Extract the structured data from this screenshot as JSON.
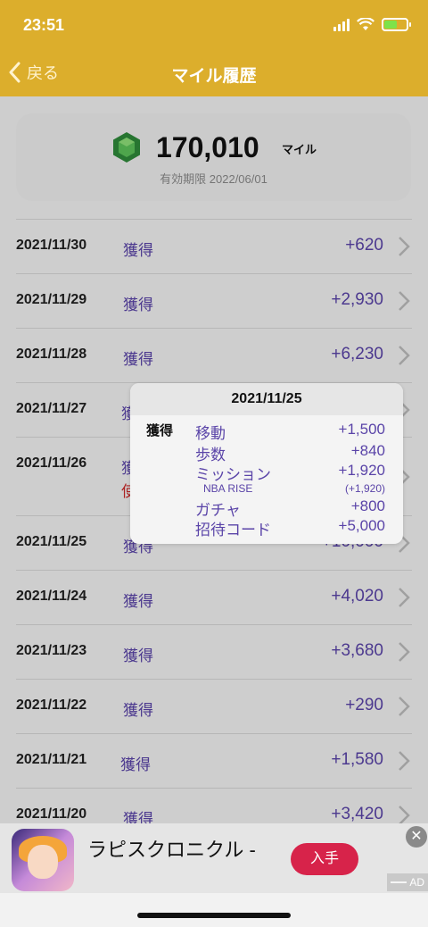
{
  "status": {
    "time": "23:51"
  },
  "nav": {
    "back_label": "戻る",
    "title": "マイル履歴"
  },
  "summary": {
    "miles": "170,010",
    "unit": "マイル",
    "expiry": "有効期限 2022/06/01"
  },
  "rows": [
    {
      "date": "2021/11/30",
      "kind": "獲得",
      "amount": "+620"
    },
    {
      "date": "2021/11/29",
      "kind": "獲得",
      "amount": "+2,930"
    },
    {
      "date": "2021/11/28",
      "kind": "獲得",
      "amount": "+6,230"
    },
    {
      "date": "2021/11/27",
      "kind": "獲",
      "amount": ""
    },
    {
      "date": "2021/11/26",
      "kind": "獲",
      "amount": "",
      "extra": "使"
    },
    {
      "date": "2021/11/25",
      "kind": "獲得",
      "amount": "+10,000"
    },
    {
      "date": "2021/11/24",
      "kind": "獲得",
      "amount": "+4,020"
    },
    {
      "date": "2021/11/23",
      "kind": "獲得",
      "amount": "+3,680"
    },
    {
      "date": "2021/11/22",
      "kind": "獲得",
      "amount": "+290"
    },
    {
      "date": "2021/11/21",
      "kind": "獲得",
      "amount": "+1,580"
    },
    {
      "date": "2021/11/20",
      "kind": "獲得",
      "amount": "+3,420"
    }
  ],
  "popup": {
    "date": "2021/11/25",
    "kind": "獲得",
    "items": [
      {
        "label": "移動",
        "value": "+1,500"
      },
      {
        "label": "歩数",
        "value": "+840"
      },
      {
        "label": "ミッション",
        "value": "+1,920"
      },
      {
        "label": "NBA RISE",
        "value": "(+1,920)"
      },
      {
        "label": "ガチャ",
        "value": "+800"
      },
      {
        "label": "招待コード",
        "value": "+5,000"
      }
    ]
  },
  "ad": {
    "title": "ラピスクロニクル -",
    "button": "入手",
    "badge": "AD",
    "close": "✕"
  },
  "colors": {
    "header": "#dcae2c",
    "accent": "#5a44a8",
    "ad_button": "#d7234a"
  }
}
